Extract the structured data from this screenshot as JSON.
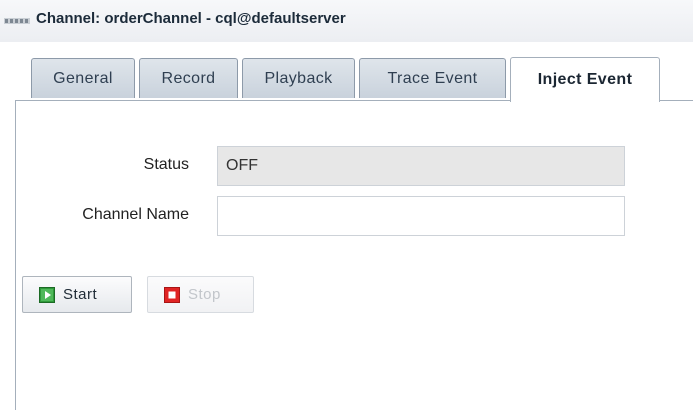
{
  "header": {
    "title": "Channel: orderChannel - cql@defaultserver",
    "icon": "channel-icon"
  },
  "tabs": [
    {
      "label": "General",
      "active": false
    },
    {
      "label": "Record",
      "active": false
    },
    {
      "label": "Playback",
      "active": false
    },
    {
      "label": "Trace Event",
      "active": false
    },
    {
      "label": "Inject Event",
      "active": true
    }
  ],
  "form": {
    "status_label": "Status",
    "status_value": "OFF",
    "channel_name_label": "Channel Name",
    "channel_name_value": ""
  },
  "buttons": {
    "start_label": "Start",
    "start_icon": "play-icon",
    "stop_label": "Stop",
    "stop_icon": "stop-icon",
    "stop_enabled": false
  },
  "colors": {
    "play_green": "#2f9a3a",
    "stop_red": "#e02424"
  }
}
